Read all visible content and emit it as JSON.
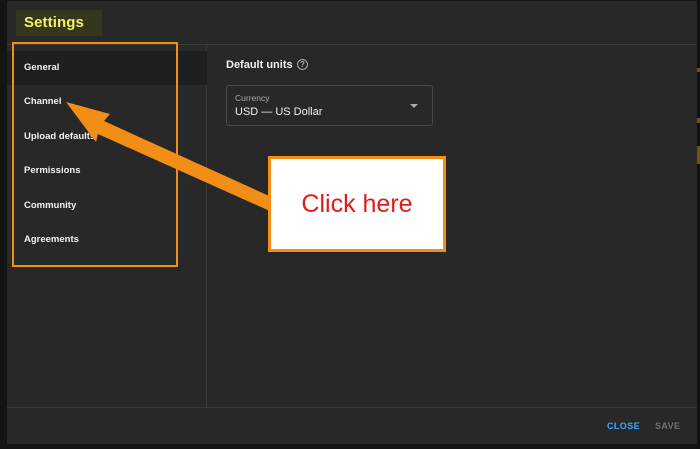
{
  "dialog": {
    "title": "Settings"
  },
  "sidebar": {
    "items": [
      {
        "label": "General",
        "active": true
      },
      {
        "label": "Channel",
        "active": false
      },
      {
        "label": "Upload defaults",
        "active": false
      },
      {
        "label": "Permissions",
        "active": false
      },
      {
        "label": "Community",
        "active": false
      },
      {
        "label": "Agreements",
        "active": false
      }
    ]
  },
  "content": {
    "section_title": "Default units",
    "help_icon": "help-circle-icon",
    "currency": {
      "label": "Currency",
      "value": "USD — US Dollar",
      "icon": "chevron-down-icon"
    }
  },
  "footer": {
    "close_label": "CLOSE",
    "save_label": "SAVE"
  },
  "annotation": {
    "callout_text": "Click here",
    "highlight_color": "#f28d18",
    "callout_text_color": "#e11a1a"
  },
  "colors": {
    "dialog_bg": "#282828",
    "title_text": "#f1f26a",
    "accent_blue": "#3ea6ff",
    "disabled_text": "#717171"
  }
}
